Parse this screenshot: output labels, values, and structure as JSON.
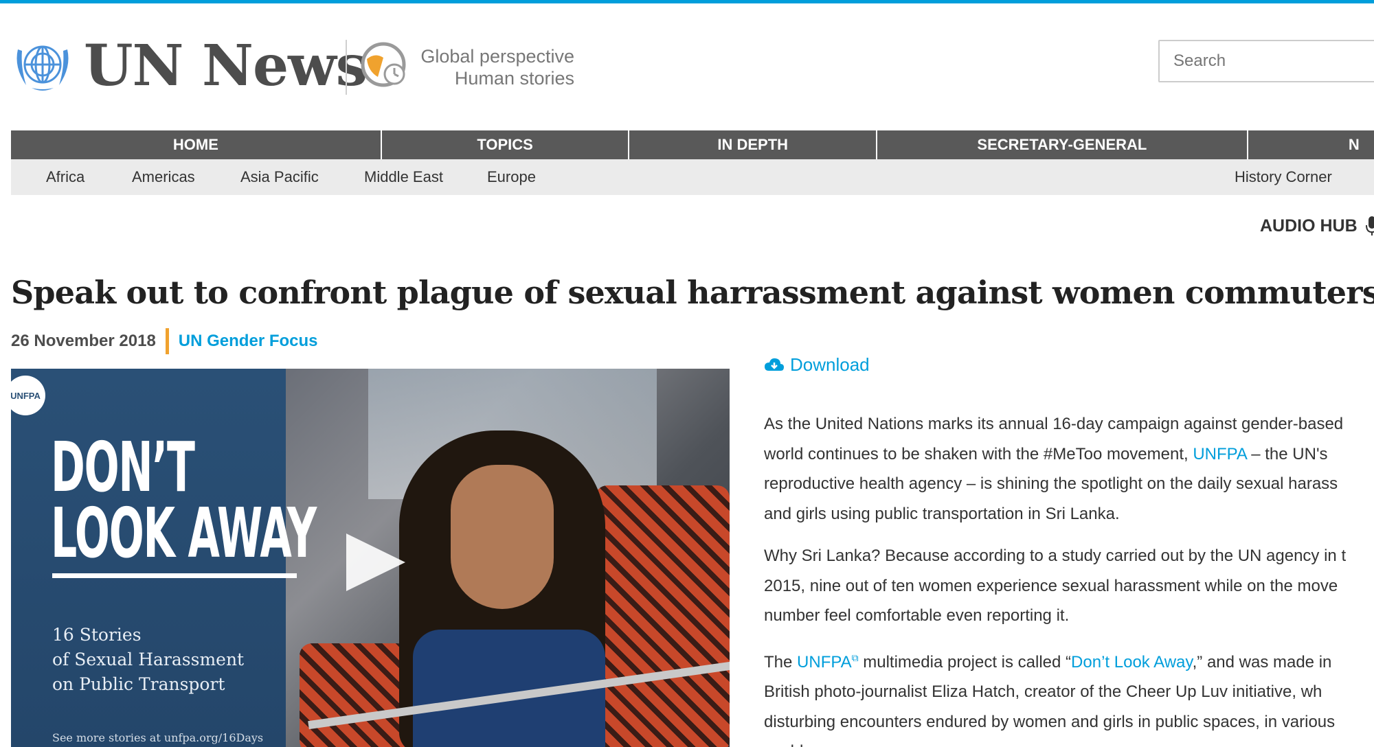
{
  "colors": {
    "accent": "#009edb",
    "nav_bg": "#595959",
    "subnav_bg": "#ebebeb",
    "focus_bar": "#f0a22e"
  },
  "header": {
    "brand": "UN News",
    "tagline_line1": "Global perspective",
    "tagline_line2": "Human stories",
    "search_placeholder": "Search"
  },
  "main_nav": [
    {
      "label": "HOME"
    },
    {
      "label": "TOPICS"
    },
    {
      "label": "IN DEPTH"
    },
    {
      "label": "SECRETARY-GENERAL"
    },
    {
      "label": "N"
    }
  ],
  "sub_nav": [
    {
      "label": "Africa"
    },
    {
      "label": "Americas"
    },
    {
      "label": "Asia Pacific"
    },
    {
      "label": "Middle East"
    },
    {
      "label": "Europe"
    },
    {
      "label": "History Corner"
    }
  ],
  "audio_hub": {
    "label": "AUDIO HUB",
    "icon": "microphone-icon"
  },
  "article": {
    "headline": "Speak out to confront plague of sexual harrassment against women commuters",
    "date": "26 November 2018",
    "focus": "UN Gender Focus"
  },
  "video": {
    "badge": "UNFPA",
    "title_line1": "DON’T",
    "title_line2": "LOOK AWAY",
    "sub_line1": "16 Stories",
    "sub_line2": "of Sexual Harassment",
    "sub_line3": "on Public Transport",
    "footer": "See more stories at unfpa.org/16Days"
  },
  "download": {
    "label": "Download",
    "icon": "cloud-download-icon"
  },
  "body": {
    "p1": {
      "l1": "As the United Nations marks its annual 16-day campaign against gender-based",
      "l2_a": "world continues to be shaken with the #MeToo movement, ",
      "l2_link": "UNFPA",
      "l2_b": " – the UN's",
      "l3": "reproductive health agency – is shining the spotlight on the daily sexual harass",
      "l4": "and girls using public transportation in Sri Lanka."
    },
    "p2": {
      "l1": "Why Sri Lanka? Because according to a study carried out by the UN agency in t",
      "l2": "2015, nine out of ten women experience sexual harassment while on the move",
      "l3": "number feel comfortable even reporting it."
    },
    "p3": {
      "l1_a": "The ",
      "l1_link1": "UNFPA",
      "l1_b": " multimedia project is called “",
      "l1_link2": "Don’t Look Away",
      "l1_c": ",” and was made in",
      "l2": "British photo-journalist Eliza Hatch, creator of the Cheer Up Luv initiative, wh",
      "l3": "disturbing encounters endured by women and girls in public spaces, in various",
      "l4": "world."
    }
  }
}
